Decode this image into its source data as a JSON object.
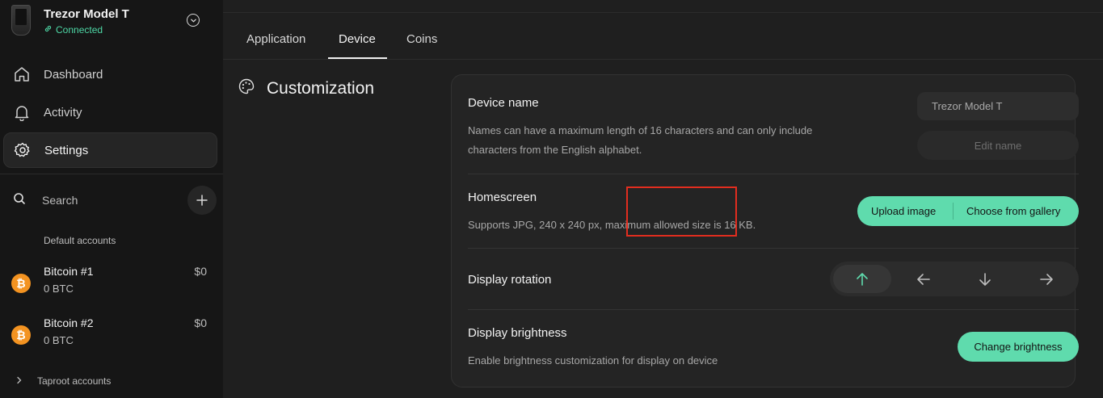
{
  "device": {
    "name": "Trezor Model T",
    "status": "Connected"
  },
  "sidebar": {
    "nav": [
      {
        "label": "Dashboard",
        "icon": "home-icon"
      },
      {
        "label": "Activity",
        "icon": "bell-icon"
      },
      {
        "label": "Settings",
        "icon": "gear-icon"
      }
    ],
    "search_label": "Search",
    "default_accounts_label": "Default accounts",
    "accounts": [
      {
        "name": "Bitcoin #1",
        "balance": "0 BTC",
        "fiat": "$0",
        "icon": "bitcoin-icon"
      },
      {
        "name": "Bitcoin #2",
        "balance": "0 BTC",
        "fiat": "$0",
        "icon": "bitcoin-icon"
      }
    ],
    "taproot_label": "Taproot accounts"
  },
  "tabs": [
    {
      "label": "Application"
    },
    {
      "label": "Device"
    },
    {
      "label": "Coins"
    }
  ],
  "active_tab": "Device",
  "section": {
    "title": "Customization"
  },
  "settings": {
    "device_name": {
      "title": "Device name",
      "description": "Names can have a maximum length of 16 characters and can only include characters from the English alphabet.",
      "input_value": "Trezor Model T",
      "button_label": "Edit name"
    },
    "homescreen": {
      "title": "Homescreen",
      "description": "Supports JPG, 240 x 240 px, maximum allowed size is 16 KB.",
      "upload_label": "Upload image",
      "gallery_label": "Choose from gallery"
    },
    "display_rotation": {
      "title": "Display rotation",
      "options": [
        "arrow-up-icon",
        "arrow-left-icon",
        "arrow-down-icon",
        "arrow-right-icon"
      ],
      "selected": "arrow-up-icon"
    },
    "display_brightness": {
      "title": "Display brightness",
      "description": "Enable brightness customization for display on device",
      "button_label": "Change brightness"
    }
  },
  "colors": {
    "accent": "#5fdbad",
    "connected": "#4ed8a6",
    "highlight": "#e22d1f",
    "bitcoin": "#f39321"
  }
}
